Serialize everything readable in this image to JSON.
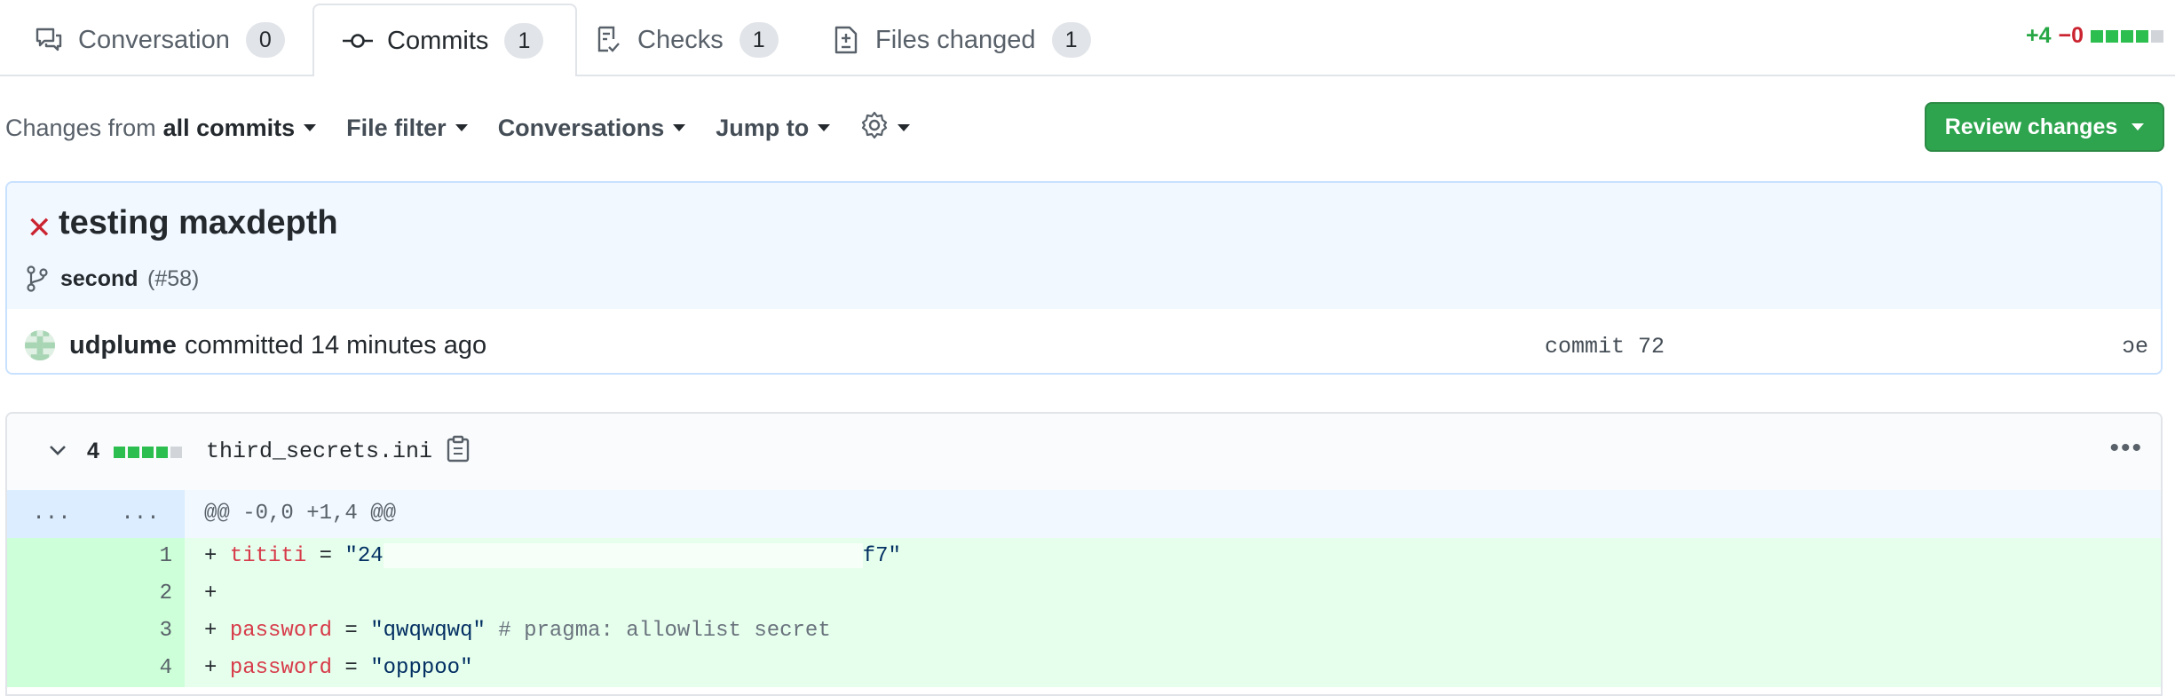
{
  "tabs": [
    {
      "label": "Conversation",
      "count": "0",
      "icon": "comment-discussion-icon"
    },
    {
      "label": "Commits",
      "count": "1",
      "icon": "git-commit-icon"
    },
    {
      "label": "Checks",
      "count": "1",
      "icon": "checklist-icon"
    },
    {
      "label": "Files changed",
      "count": "1",
      "icon": "file-diff-icon"
    }
  ],
  "diffstat": {
    "additions": "+4",
    "deletions": "−0",
    "blocks": [
      1,
      1,
      1,
      1,
      0
    ]
  },
  "toolbar": {
    "changes_prefix": "Changes from",
    "changes_value": "all commits",
    "file_filter": "File filter",
    "conversations": "Conversations",
    "jump_to": "Jump to",
    "settings_icon": "gear-icon",
    "review_button": "Review changes"
  },
  "commit": {
    "status": "failed",
    "title": "testing maxdepth",
    "branch": "second",
    "pr": "(#58)",
    "author": "udplume",
    "committed_text": "committed 14 minutes ago",
    "sha_prefix": "commit 72",
    "sha_suffix": "ɔe"
  },
  "file": {
    "change_count": "4",
    "name": "third_secrets.ini",
    "hunk_left": "...",
    "hunk_right": "...",
    "hunk_header": "@@ -0,0 +1,4 @@",
    "lines": [
      {
        "num": "1",
        "plus": "+ ",
        "key": "tititi",
        "eq": " = ",
        "val_start": "\"24",
        "val_end": "f7\"",
        "comment": ""
      },
      {
        "num": "2",
        "plus": "+",
        "key": "",
        "eq": "",
        "val_start": "",
        "val_end": "",
        "comment": ""
      },
      {
        "num": "3",
        "plus": "+ ",
        "key": "password",
        "eq": " = ",
        "val_start": "\"qwqwqwq\"",
        "val_end": "",
        "comment": " # pragma: allowlist secret"
      },
      {
        "num": "4",
        "plus": "+ ",
        "key": "password",
        "eq": " = ",
        "val_start": "\"opppoo\"",
        "val_end": "",
        "comment": ""
      }
    ]
  },
  "colors": {
    "green": "#2ea44f",
    "red": "#cb2431",
    "added_bg": "#e6ffed",
    "hunk_bg": "#f1f8ff"
  }
}
